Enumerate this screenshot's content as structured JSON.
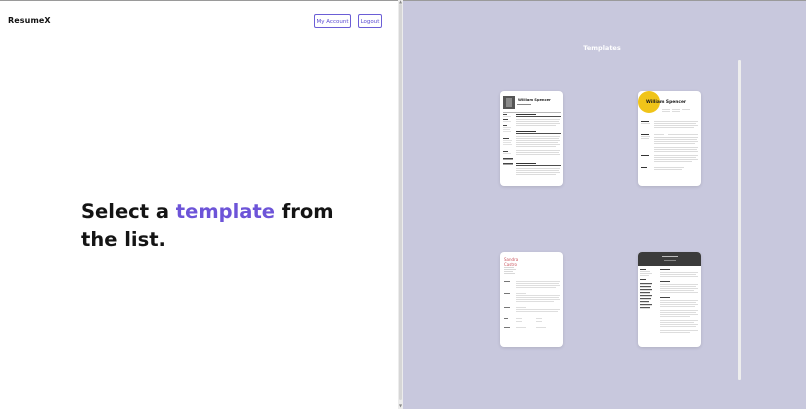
{
  "app": {
    "logo": "ResumeX"
  },
  "header": {
    "account_label": "My Account",
    "logout_label": "Logout"
  },
  "hero": {
    "line_prefix": "Select a ",
    "accent": "template",
    "line_suffix": " from",
    "line2": "the list."
  },
  "templates": {
    "title": "Templates",
    "items": [
      {
        "name": "William Spencer",
        "style": "photo-header"
      },
      {
        "name": "William Spencer",
        "style": "yellow-circle"
      },
      {
        "name_line1": "Sandra",
        "name_line2": "Castro",
        "style": "red-name"
      },
      {
        "style": "dark-banner"
      }
    ]
  },
  "colors": {
    "accent": "#6d54d8",
    "panel": "#c8c8dd",
    "yellow": "#f0c419",
    "red_name": "#c8505a",
    "banner": "#3b3b3b"
  }
}
